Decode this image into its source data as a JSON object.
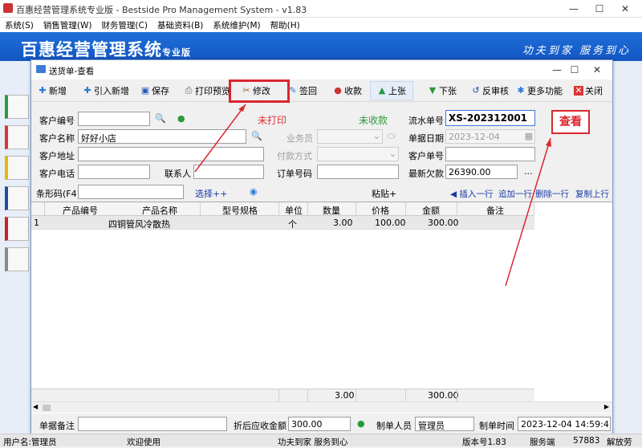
{
  "main_window": {
    "title": "百惠经营管理系统专业版 - Bestside Pro Management System - v1.83",
    "controls": {
      "minimize": "—",
      "maximize": "☐",
      "close": "✕"
    }
  },
  "menu": [
    "系统(S)",
    "销售管理(W)",
    "财务管理(C)",
    "基础资料(B)",
    "系统维护(M)",
    "帮助(H)"
  ],
  "banner": {
    "title": "百惠经营管理系统",
    "edition": "专业版",
    "slogan": "功夫到家 服务到心"
  },
  "child_window": {
    "title": "送货单-查看",
    "controls": {
      "minimize": "—",
      "maximize": "☐",
      "close": "✕"
    }
  },
  "toolbar": [
    {
      "icon": "plus-icon",
      "label": "新增"
    },
    {
      "icon": "plus-icon",
      "label": "引入新增"
    },
    {
      "icon": "save-icon",
      "label": "保存"
    },
    {
      "icon": "print-icon",
      "label": "打印预览"
    },
    {
      "icon": "tools-icon",
      "label": "修改"
    },
    {
      "icon": "sign-icon",
      "label": "签回"
    },
    {
      "icon": "money-icon",
      "label": "收款"
    },
    {
      "icon": "up-icon",
      "label": "上张"
    },
    {
      "icon": "down-icon",
      "label": "下张"
    },
    {
      "icon": "unreview-icon",
      "label": "反审核"
    },
    {
      "icon": "more-icon",
      "label": "更多功能"
    },
    {
      "icon": "close-icon",
      "label": "关闭"
    }
  ],
  "form": {
    "customer_code_label": "客户编号",
    "customer_code": "",
    "customer_name_label": "客户名称",
    "customer_name": "好好小店",
    "customer_address_label": "客户地址",
    "customer_address": "",
    "customer_phone_label": "客户电话",
    "customer_phone": "",
    "contact_label": "联系人",
    "contact": "",
    "print_status": "未打印",
    "pay_status": "未收款",
    "salesman_label": "业务员",
    "payment_method_label": "付款方式",
    "order_no_label": "订单号码",
    "order_no": "",
    "serial_label": "流水单号",
    "serial": "XS-202312001",
    "date_label": "单据日期",
    "date": "2023-12-04",
    "customer_doc_label": "客户单号",
    "customer_doc": "",
    "latest_debt_label": "最新欠款",
    "latest_debt": "26390.00",
    "more_btn": "...",
    "view_badge": "查看"
  },
  "barcode": {
    "label": "条形码(F4)",
    "value": "",
    "select": "选择++",
    "paste": "粘贴+"
  },
  "row_actions": {
    "insert": "插入一行",
    "append": "追加一行",
    "delete": "删除一行",
    "copy": "复制上行"
  },
  "grid": {
    "columns": [
      "产品编号",
      "产品名称",
      "型号规格",
      "单位",
      "数量",
      "价格",
      "金额",
      "备注"
    ],
    "rows": [
      [
        "1",
        "",
        "四铜管风冷散热",
        "",
        "个",
        "3.00",
        "100.00",
        "300.00",
        ""
      ]
    ],
    "totals": {
      "quantity": "3.00",
      "amount": "300.00"
    }
  },
  "bottom": {
    "remark_label": "单据备注",
    "remark": "",
    "receivable_label": "折后应收金额",
    "receivable": "300.00",
    "maker_label": "制单人员",
    "maker": "管理员",
    "make_time_label": "制单时间",
    "make_time": "2023-12-04 14:59:41"
  },
  "statusbar": {
    "user": "用户名:管理员",
    "welcome": "欢迎使用",
    "slogan": "功夫到家 服务到心",
    "version": "版本号1.83",
    "side": "服务端",
    "port": "57883",
    "tail": "解放劳"
  }
}
